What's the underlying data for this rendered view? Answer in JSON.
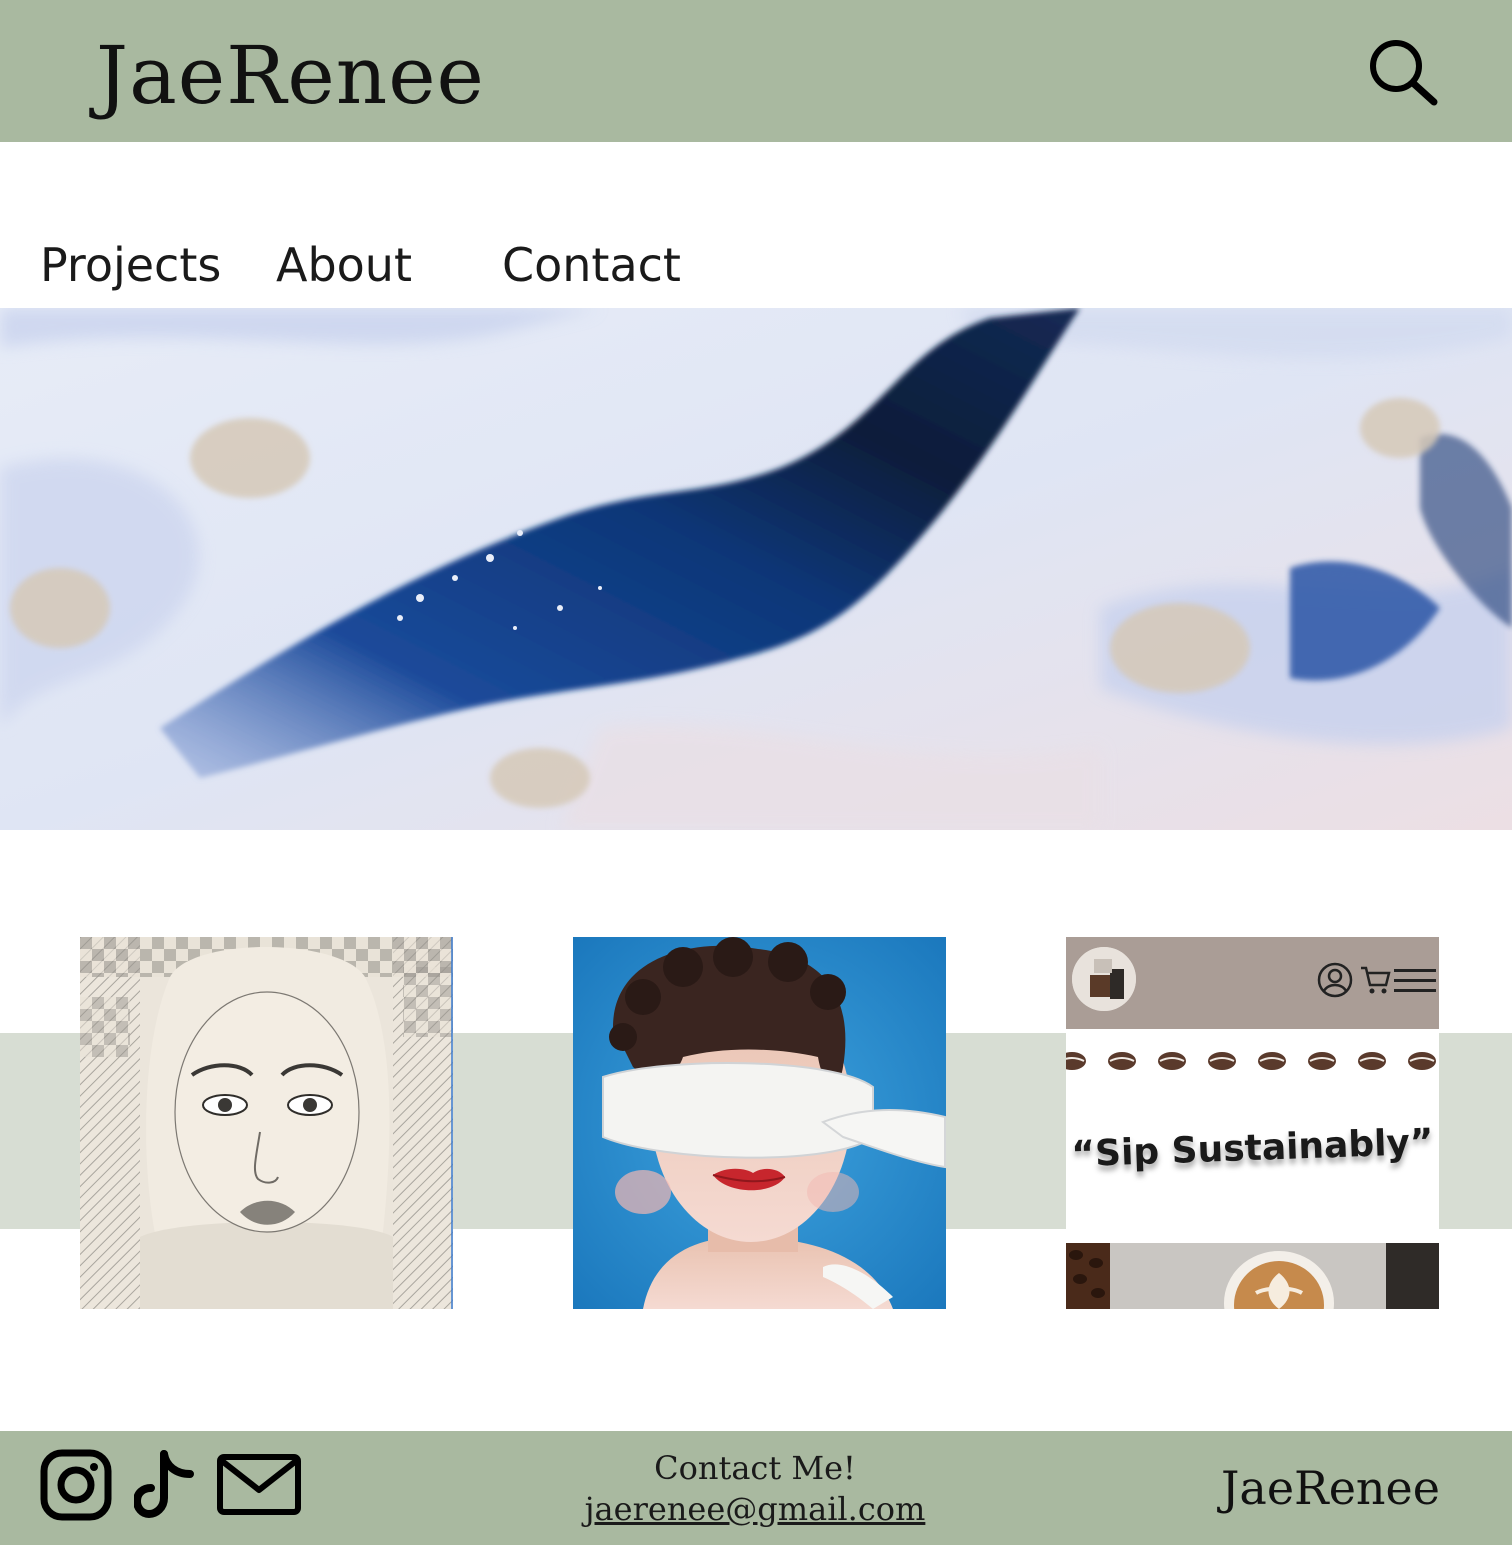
{
  "header": {
    "brand": "JaeRenee",
    "search_icon": "search-icon"
  },
  "nav": {
    "items": [
      {
        "label": "Projects"
      },
      {
        "label": "About"
      },
      {
        "label": "Contact"
      }
    ]
  },
  "hero": {
    "image": "abstract-blue-white-paint-texture"
  },
  "gallery": {
    "tiles": [
      {
        "image": "pencil-portrait-zentangle"
      },
      {
        "image": "blindfolded-portrait-painting"
      },
      {
        "image": "coffee-app-mockup",
        "tagline": "“Sip Sustainably”"
      }
    ]
  },
  "footer": {
    "social_icons": [
      "instagram-icon",
      "tiktok-icon",
      "mail-icon"
    ],
    "contact_title": "Contact Me!",
    "contact_email": " jaerenee@gmail.com",
    "brand": "JaeRenee"
  },
  "colors": {
    "header_bg": "#a9b9a0",
    "band_bg": "#d7ddd3",
    "app_bar": "#aa9d96"
  }
}
